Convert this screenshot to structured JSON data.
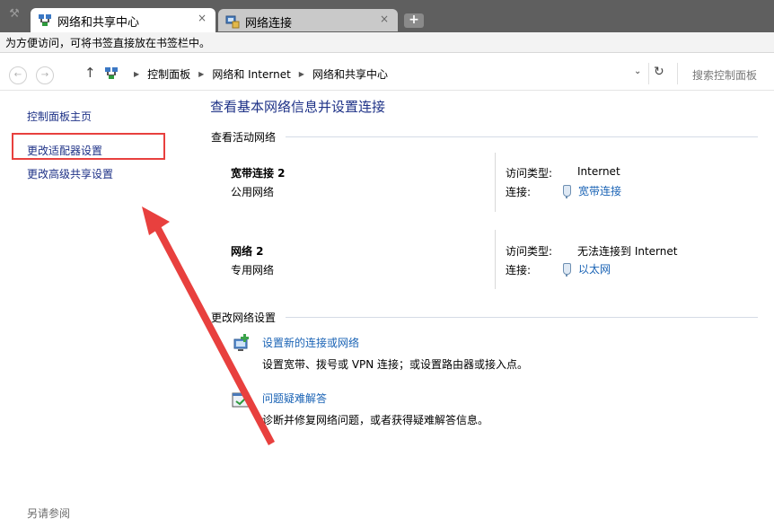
{
  "browser": {
    "tabs": [
      {
        "label": "网络和共享中心",
        "active": true
      },
      {
        "label": "网络连接",
        "active": false
      }
    ],
    "close_glyph": "×",
    "new_tab_glyph": "+",
    "bookmark_hint": "为方便访问，可将书签直接放在书签栏中。"
  },
  "address": {
    "breadcrumbs": [
      "控制面板",
      "网络和 Internet",
      "网络和共享中心"
    ],
    "search_placeholder": "搜索控制面板"
  },
  "sidebar": {
    "links": [
      "控制面板主页",
      "更改适配器设置",
      "更改高级共享设置"
    ],
    "see_also": "另请参阅"
  },
  "main": {
    "title": "查看基本网络信息并设置连接",
    "active_networks_heading": "查看活动网络",
    "networks": [
      {
        "name": "宽带连接  2",
        "type": "公用网络",
        "access_label": "访问类型:",
        "access_value": "Internet",
        "conn_label": "连接:",
        "conn_value": "宽带连接"
      },
      {
        "name": "网络  2",
        "type": "专用网络",
        "access_label": "访问类型:",
        "access_value": "无法连接到 Internet",
        "conn_label": "连接:",
        "conn_value": "以太网"
      }
    ],
    "change_settings_heading": "更改网络设置",
    "tasks": [
      {
        "link": "设置新的连接或网络",
        "desc": "设置宽带、拨号或 VPN 连接；或设置路由器或接入点。"
      },
      {
        "link": "问题疑难解答",
        "desc": "诊断并修复网络问题，或者获得疑难解答信息。"
      }
    ]
  },
  "colors": {
    "annotation": "#e8403e",
    "link": "#1a63b5",
    "title": "#1e3287"
  }
}
